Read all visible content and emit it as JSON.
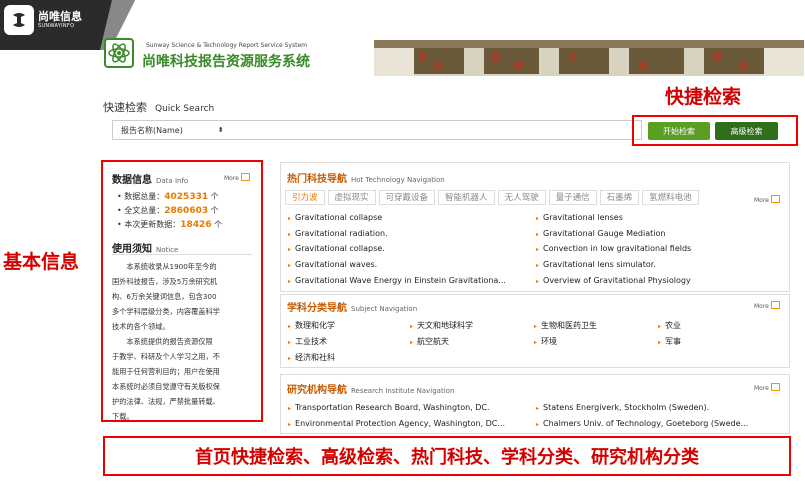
{
  "corner_logo": {
    "cn": "尚唯信息",
    "en": "SUNWAYINFO"
  },
  "site_logo": {
    "en": "Sunway Science & Technology Report Service System",
    "cn": "尚唯科技报告资源服务系统"
  },
  "quick_search": {
    "title_cn": "快速检索",
    "title_en": "Quick Search",
    "field": "报告名称(Name)",
    "caret": "⬍",
    "start_button": "开始检索",
    "advanced_button": "高级检索"
  },
  "annotations": {
    "quick": "快捷检索",
    "basic": "基本信息",
    "bottom": "首页快捷检索、高级检索、热门科技、学科分类、研究机构分类"
  },
  "data_info": {
    "title_cn": "数据信息",
    "title_en": "Data Info",
    "more": "More",
    "stats": [
      {
        "label": "数据总量：",
        "value": "4025331",
        "unit": " 个"
      },
      {
        "label": "全文总量：",
        "value": "2860603",
        "unit": " 个"
      },
      {
        "label": "本次更新数据：",
        "value": "18426",
        "unit": " 个"
      }
    ]
  },
  "notice": {
    "title_cn": "使用须知",
    "title_en": "Notice",
    "lines": [
      "本系统收录从1900年至今的",
      "国外科技报告，涉及5万余研究机",
      "构、6万余关键词信息，包含300",
      "多个学科层级分类，内容覆盖科学",
      "技术的各个领域。",
      "本系统提供的报告资源仅限",
      "于教学、科研及个人学习之用，不",
      "能用于任何营利目的；用户在使用",
      "本系统时必须自觉遵守有关版权保",
      "护的法律、法规，严禁批量转载、",
      "下载。"
    ]
  },
  "hot_tech": {
    "title_cn": "热门科技导航",
    "title_en": "Hot Technology Navigation",
    "more": "More",
    "tabs": [
      "引力波",
      "虚拟现实",
      "可穿戴设备",
      "智能机器人",
      "无人驾驶",
      "量子通信",
      "石墨烯",
      "氢燃料电池"
    ],
    "left": [
      "Gravitational collapse",
      "Gravitational radiation.",
      "Gravitational collapse.",
      "Gravitational waves.",
      "Gravitational Wave Energy in Einstein Gravitationa..."
    ],
    "right": [
      "Gravitational lenses",
      "Gravitational Gauge Mediation",
      "Convection in low gravitational fields",
      "Gravitational lens simulator.",
      "Overview of Gravitational Physiology"
    ]
  },
  "subject": {
    "title_cn": "学科分类导航",
    "title_en": "Subject Navigation",
    "more": "More",
    "items": [
      "数理和化学",
      "天文和地球科学",
      "生物和医药卫生",
      "农业",
      "工业技术",
      "航空航天",
      "环境",
      "军事",
      "经济和社科"
    ]
  },
  "institute": {
    "title_cn": "研究机构导航",
    "title_en": "Research Institute Navigation",
    "more": "More",
    "items": [
      "Transportation Research Board, Washington, DC.",
      "Statens Energiverk, Stockholm (Sweden).",
      "Environmental Protection Agency, Washington, DC...",
      "Chalmers Univ. of Technology, Goeteborg (Swede..."
    ]
  }
}
